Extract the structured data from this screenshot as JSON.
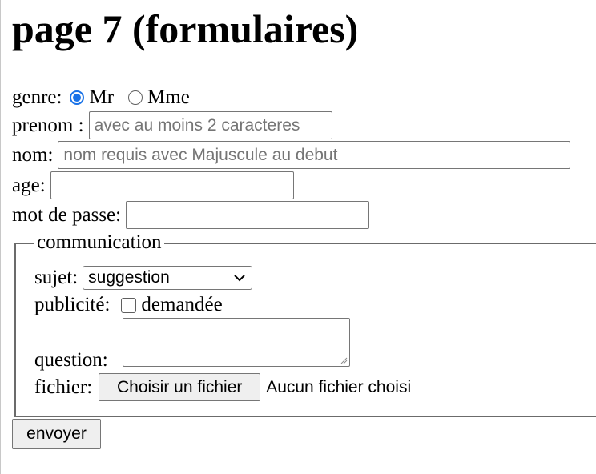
{
  "page": {
    "title": "page 7 (formulaires)"
  },
  "form": {
    "genre": {
      "label": "genre:",
      "options": [
        {
          "label": "Mr",
          "checked": true
        },
        {
          "label": "Mme",
          "checked": false
        }
      ]
    },
    "prenom": {
      "label": "prenom :",
      "value": "",
      "placeholder": "avec au moins 2 caracteres"
    },
    "nom": {
      "label": "nom:",
      "value": "",
      "placeholder": "nom requis avec Majuscule au debut"
    },
    "age": {
      "label": "age:",
      "value": ""
    },
    "password": {
      "label": "mot de passe:",
      "value": ""
    },
    "communication": {
      "legend": "communication",
      "sujet": {
        "label": "sujet:",
        "selected": "suggestion"
      },
      "publicite": {
        "label": "publicité:",
        "checkbox_label": "demandée",
        "checked": false
      },
      "question": {
        "label": "question:",
        "value": ""
      },
      "fichier": {
        "label": "fichier:",
        "button_label": "Choisir un fichier",
        "status": "Aucun fichier choisi"
      }
    },
    "submit_label": "envoyer"
  },
  "colors": {
    "accent": "#1a73e8",
    "border": "#767676",
    "button_bg": "#efefef",
    "placeholder": "#757575"
  }
}
